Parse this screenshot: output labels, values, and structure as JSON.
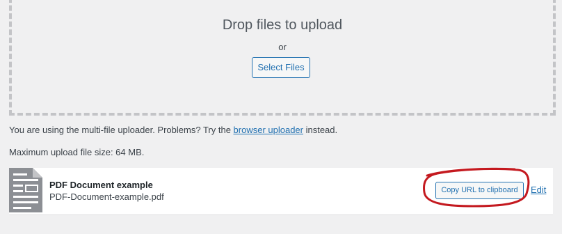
{
  "dropzone": {
    "title": "Drop files to upload",
    "or_text": "or",
    "select_button": "Select Files"
  },
  "info": {
    "prefix": "You are using the multi-file uploader. Problems? Try the ",
    "link_text": "browser uploader",
    "suffix": " instead."
  },
  "max_upload": "Maximum upload file size: 64 MB.",
  "media_item": {
    "title": "PDF Document example",
    "filename": "PDF-Document-example.pdf",
    "copy_button": "Copy URL to clipboard",
    "edit_link": "Edit",
    "icon": "document-icon"
  },
  "colors": {
    "accent": "#2271b1",
    "background": "#f0f0f1",
    "annotation": "#c4191f"
  }
}
